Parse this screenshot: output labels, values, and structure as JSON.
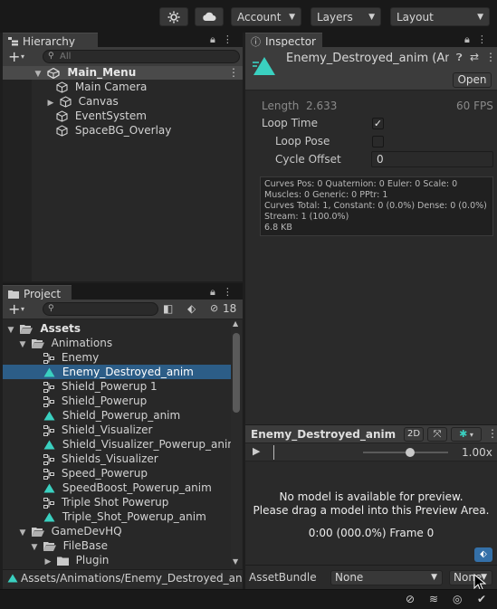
{
  "toolbar": {
    "account_label": "Account",
    "layers_label": "Layers",
    "layout_label": "Layout"
  },
  "hierarchy": {
    "tab_label": "Hierarchy",
    "search_placeholder": "All",
    "root": "Main_Menu",
    "items": [
      "Main Camera",
      "Canvas",
      "EventSystem",
      "SpaceBG_Overlay"
    ]
  },
  "project": {
    "tab_label": "Project",
    "hidden_count": "18",
    "tree": {
      "assets": "Assets",
      "animations": "Animations",
      "files": [
        "Enemy",
        "Enemy_Destroyed_anim",
        "Shield_Powerup 1",
        "Shield_Powerup",
        "Shield_Powerup_anim",
        "Shield_Visualizer",
        "Shield_Visualizer_Powerup_anim",
        "Shields_Visualizer",
        "Speed_Powerup",
        "SpeedBoost_Powerup_anim",
        "Triple Shot Powerup",
        "Triple_Shot_Powerup_anim"
      ],
      "gamedevhq": "GameDevHQ",
      "filebase": "FileBase",
      "plugin": "Plugin"
    },
    "path": "Assets/Animations/Enemy_Destroyed_anim"
  },
  "inspector": {
    "tab_label": "Inspector",
    "asset_title": "Enemy_Destroyed_anim (Ani",
    "open_button": "Open",
    "length_label": "Length",
    "length_value": "2.633",
    "fps": "60 FPS",
    "loop_time_label": "Loop Time",
    "loop_pose_label": "Loop Pose",
    "cycle_offset_label": "Cycle Offset",
    "cycle_offset_value": "0",
    "stats": [
      "Curves Pos: 0 Quaternion: 0 Euler: 0 Scale: 0",
      "Muscles: 0 Generic: 0 PPtr: 1",
      "Curves Total: 1, Constant: 0 (0.0%) Dense: 0 (0.0%)",
      "Stream: 1 (100.0%)",
      "6.8 KB"
    ]
  },
  "preview": {
    "title": "Enemy_Destroyed_anim",
    "mode_2d": "2D",
    "speed": "1.00x",
    "message_line1": "No model is available for preview.",
    "message_line2": "Please drag a model into this Preview Area.",
    "time": "0:00 (000.0%) Frame 0"
  },
  "assetbundle": {
    "label": "AssetBundle",
    "name_value": "None",
    "variant_value": "None"
  },
  "colors": {
    "selection": "#2c5d87",
    "anim_icon": "#3ad0c0",
    "panel_bg": "#282828"
  }
}
